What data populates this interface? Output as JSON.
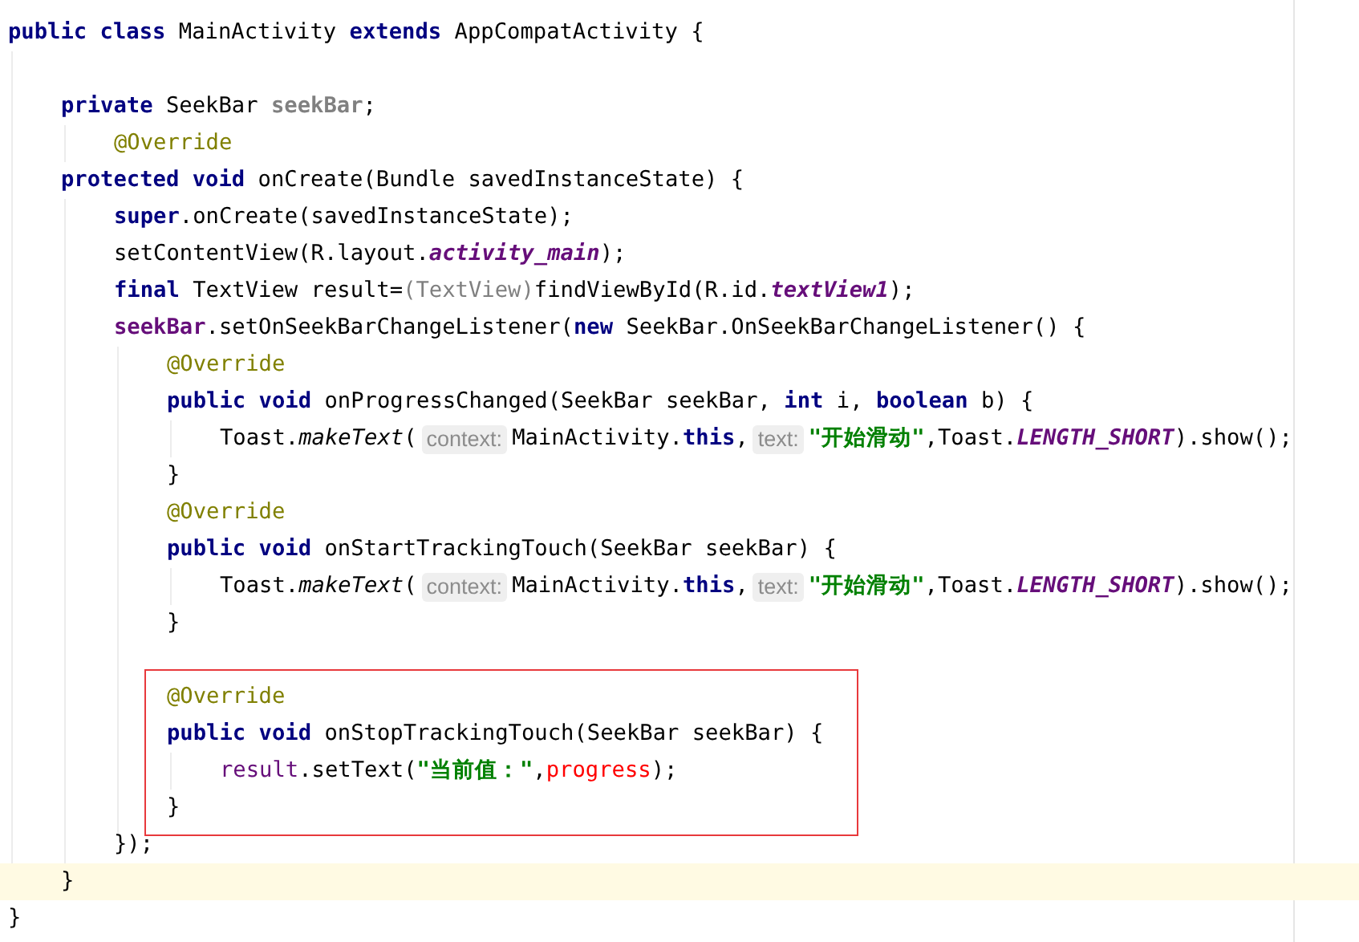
{
  "editor": {
    "lines": [
      {
        "kind": "line",
        "tokens": [
          {
            "t": "public class",
            "kind": "keyword"
          },
          {
            "t": " MainActivity ",
            "kind": "plain"
          },
          {
            "t": "extends",
            "kind": "keyword"
          },
          {
            "t": " AppCompatActivity {",
            "kind": "plain"
          }
        ],
        "children": [
          {
            "kind": "blank"
          },
          {
            "kind": "line",
            "tokens": [
              {
                "t": "private",
                "kind": "keyword"
              },
              {
                "t": " SeekBar ",
                "kind": "plain"
              },
              {
                "t": "seekBar",
                "kind": "unused"
              },
              {
                "t": ";",
                "kind": "plain"
              }
            ],
            "children": [
              {
                "kind": "line",
                "tokens": [
                  {
                    "t": "@Override",
                    "kind": "annotation"
                  }
                ]
              }
            ]
          },
          {
            "kind": "line",
            "tokens": [
              {
                "t": "protected void",
                "kind": "keyword"
              },
              {
                "t": " onCreate(Bundle savedInstanceState) {",
                "kind": "plain"
              }
            ],
            "children": [
              {
                "kind": "line",
                "tokens": [
                  {
                    "t": "super",
                    "kind": "keyword"
                  },
                  {
                    "t": ".onCreate(savedInstanceState);",
                    "kind": "plain"
                  }
                ]
              },
              {
                "kind": "line",
                "tokens": [
                  {
                    "t": "setContentView(R.layout.",
                    "kind": "plain"
                  },
                  {
                    "t": "activity_main",
                    "kind": "static_field"
                  },
                  {
                    "t": ");",
                    "kind": "plain"
                  }
                ]
              },
              {
                "kind": "line",
                "tokens": [
                  {
                    "t": "final",
                    "kind": "keyword"
                  },
                  {
                    "t": " TextView result=",
                    "kind": "plain"
                  },
                  {
                    "t": "(TextView)",
                    "kind": "redundant"
                  },
                  {
                    "t": "findViewById(R.id.",
                    "kind": "plain"
                  },
                  {
                    "t": "textView1",
                    "kind": "static_field"
                  },
                  {
                    "t": ");",
                    "kind": "plain"
                  }
                ]
              },
              {
                "kind": "line",
                "tokens": [
                  {
                    "t": "seekBar",
                    "kind": "field"
                  },
                  {
                    "t": ".setOnSeekBarChangeListener(",
                    "kind": "plain"
                  },
                  {
                    "t": "new",
                    "kind": "keyword"
                  },
                  {
                    "t": " SeekBar.OnSeekBarChangeListener() {",
                    "kind": "plain"
                  }
                ],
                "children": [
                  {
                    "kind": "line",
                    "tokens": [
                      {
                        "t": "@Override",
                        "kind": "annotation"
                      }
                    ]
                  },
                  {
                    "kind": "line",
                    "tokens": [
                      {
                        "t": "public void",
                        "kind": "keyword"
                      },
                      {
                        "t": " onProgressChanged(SeekBar seekBar, ",
                        "kind": "plain"
                      },
                      {
                        "t": "int",
                        "kind": "keyword"
                      },
                      {
                        "t": " i, ",
                        "kind": "plain"
                      },
                      {
                        "t": "boolean",
                        "kind": "keyword"
                      },
                      {
                        "t": " b) {",
                        "kind": "plain"
                      }
                    ],
                    "children": [
                      {
                        "kind": "line",
                        "tokens": [
                          {
                            "t": "Toast.",
                            "kind": "plain"
                          },
                          {
                            "t": "makeText",
                            "kind": "static_method"
                          },
                          {
                            "t": "(",
                            "kind": "plain"
                          },
                          {
                            "t": "context:",
                            "kind": "hint"
                          },
                          {
                            "t": "MainActivity.",
                            "kind": "plain"
                          },
                          {
                            "t": "this",
                            "kind": "keyword"
                          },
                          {
                            "t": ",",
                            "kind": "plain"
                          },
                          {
                            "t": "text:",
                            "kind": "hint"
                          },
                          {
                            "t": "\"开始滑动\"",
                            "kind": "string"
                          },
                          {
                            "t": ",Toast.",
                            "kind": "plain"
                          },
                          {
                            "t": "LENGTH_SHORT",
                            "kind": "static_field"
                          },
                          {
                            "t": ").show();",
                            "kind": "plain"
                          }
                        ]
                      }
                    ]
                  },
                  {
                    "kind": "line",
                    "tokens": [
                      {
                        "t": "}",
                        "kind": "plain"
                      }
                    ]
                  },
                  {
                    "kind": "line",
                    "tokens": [
                      {
                        "t": "@Override",
                        "kind": "annotation"
                      }
                    ]
                  },
                  {
                    "kind": "line",
                    "tokens": [
                      {
                        "t": "public void",
                        "kind": "keyword"
                      },
                      {
                        "t": " onStartTrackingTouch(SeekBar seekBar) {",
                        "kind": "plain"
                      }
                    ],
                    "children": [
                      {
                        "kind": "line",
                        "tokens": [
                          {
                            "t": "Toast.",
                            "kind": "plain"
                          },
                          {
                            "t": "makeText",
                            "kind": "static_method"
                          },
                          {
                            "t": "(",
                            "kind": "plain"
                          },
                          {
                            "t": "context:",
                            "kind": "hint"
                          },
                          {
                            "t": "MainActivity.",
                            "kind": "plain"
                          },
                          {
                            "t": "this",
                            "kind": "keyword"
                          },
                          {
                            "t": ",",
                            "kind": "plain"
                          },
                          {
                            "t": "text:",
                            "kind": "hint"
                          },
                          {
                            "t": "\"开始滑动\"",
                            "kind": "string"
                          },
                          {
                            "t": ",Toast.",
                            "kind": "plain"
                          },
                          {
                            "t": "LENGTH_SHORT",
                            "kind": "static_field"
                          },
                          {
                            "t": ").show();",
                            "kind": "plain"
                          }
                        ]
                      }
                    ]
                  },
                  {
                    "kind": "line",
                    "tokens": [
                      {
                        "t": "}",
                        "kind": "plain"
                      }
                    ]
                  },
                  {
                    "kind": "blank"
                  },
                  {
                    "kind": "box",
                    "children": [
                      {
                        "kind": "line",
                        "tokens": [
                          {
                            "t": "@Override",
                            "kind": "annotation"
                          }
                        ]
                      },
                      {
                        "kind": "line",
                        "tokens": [
                          {
                            "t": "public void",
                            "kind": "keyword"
                          },
                          {
                            "t": " onStopTrackingTouch(SeekBar seekBar) {",
                            "kind": "plain"
                          }
                        ],
                        "children": [
                          {
                            "kind": "line",
                            "tokens": [
                              {
                                "t": "result",
                                "kind": "variable"
                              },
                              {
                                "t": ".setText(",
                                "kind": "plain"
                              },
                              {
                                "t": "\"当前值：\"",
                                "kind": "string"
                              },
                              {
                                "t": ",",
                                "kind": "plain"
                              },
                              {
                                "t": "progress",
                                "kind": "error"
                              },
                              {
                                "t": ");",
                                "kind": "plain"
                              }
                            ]
                          }
                        ]
                      },
                      {
                        "kind": "line",
                        "tokens": [
                          {
                            "t": "}",
                            "kind": "plain"
                          }
                        ]
                      }
                    ]
                  }
                ]
              },
              {
                "kind": "line",
                "tokens": [
                  {
                    "t": "});",
                    "kind": "plain"
                  }
                ]
              }
            ]
          },
          {
            "kind": "current_line",
            "tokens": [
              {
                "t": "}",
                "kind": "plain"
              }
            ]
          }
        ]
      },
      {
        "kind": "line",
        "tokens": [
          {
            "t": "}",
            "kind": "plain"
          }
        ]
      }
    ]
  }
}
